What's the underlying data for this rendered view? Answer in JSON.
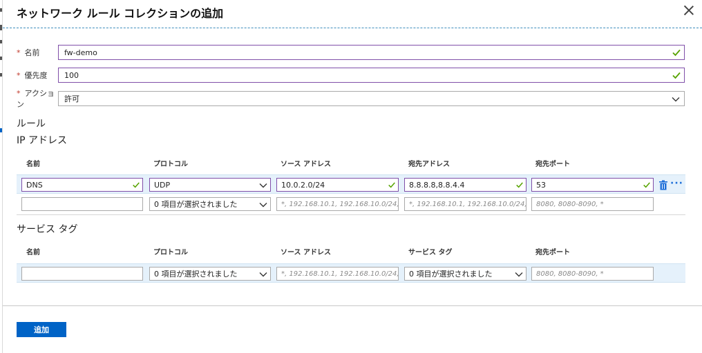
{
  "panel": {
    "title": "ネットワーク ルール コレクションの追加"
  },
  "form": {
    "required_mark": "*",
    "name": {
      "label": "名前",
      "value": "fw-demo"
    },
    "priority": {
      "label": "優先度",
      "value": "100"
    },
    "action": {
      "label": "アクション",
      "value": "許可"
    }
  },
  "rules": {
    "title": "ルール",
    "ip": {
      "title": "IP アドレス",
      "headers": [
        "名前",
        "プロトコル",
        "ソース アドレス",
        "宛先アドレス",
        "宛先ポート"
      ],
      "row1": {
        "name": "DNS",
        "protocol": "UDP",
        "source": "10.0.2.0/24",
        "destination": "8.8.8.8,8.8.4.4",
        "port": "53"
      },
      "row2": {
        "protocol": "0 項目が選択されました",
        "source_placeholder": "*, 192.168.10.1, 192.168.10.0/24,...",
        "destination_placeholder": "*, 192.168.10.1, 192.168.10.0/24,...",
        "port_placeholder": "8080, 8080-8090, *"
      },
      "more_label": "···"
    },
    "service": {
      "title": "サービス タグ",
      "headers": [
        "名前",
        "プロトコル",
        "ソース アドレス",
        "サービス タグ",
        "宛先ポート"
      ],
      "row1": {
        "protocol": "0 項目が選択されました",
        "source_placeholder": "*, 192.168.10.1, 192.168.10.0/24,...",
        "service_tag": "0 項目が選択されました",
        "port_placeholder": "8080, 8080-8090, *"
      }
    }
  },
  "footer": {
    "add_label": "追加"
  },
  "colors": {
    "primary": "#0063c6",
    "valid_border": "#7f4ea8",
    "check": "#57a300",
    "required": "#c0392b",
    "row_highlight": "#e5f1fb"
  }
}
